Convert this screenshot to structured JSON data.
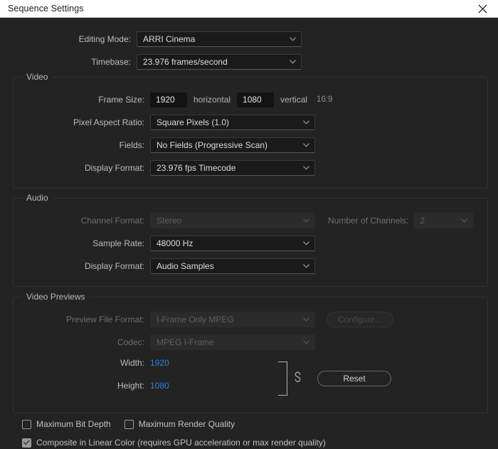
{
  "window": {
    "title": "Sequence Settings",
    "close_icon": "close-icon"
  },
  "top": {
    "editing_mode": {
      "label": "Editing Mode:",
      "value": "ARRI Cinema"
    },
    "timebase": {
      "label": "Timebase:",
      "value": "23.976  frames/second"
    }
  },
  "video": {
    "legend": "Video",
    "frame_size": {
      "label": "Frame Size:",
      "horizontal_value": "1920",
      "horizontal_text": "horizontal",
      "vertical_value": "1080",
      "vertical_text": "vertical",
      "aspect_ratio": "16:9"
    },
    "pixel_aspect_ratio": {
      "label": "Pixel Aspect Ratio:",
      "value": "Square Pixels (1.0)"
    },
    "fields": {
      "label": "Fields:",
      "value": "No Fields (Progressive Scan)"
    },
    "display_format": {
      "label": "Display Format:",
      "value": "23.976 fps Timecode"
    }
  },
  "audio": {
    "legend": "Audio",
    "channel_format": {
      "label": "Channel Format:",
      "value": "Stereo"
    },
    "number_of_channels": {
      "label": "Number of Channels:",
      "value": "2"
    },
    "sample_rate": {
      "label": "Sample Rate:",
      "value": "48000 Hz"
    },
    "display_format": {
      "label": "Display Format:",
      "value": "Audio Samples"
    }
  },
  "video_previews": {
    "legend": "Video Previews",
    "preview_file_format": {
      "label": "Preview File Format:",
      "value": "I-Frame Only MPEG"
    },
    "configure_button": "Configure...",
    "codec": {
      "label": "Codec:",
      "value": "MPEG I-Frame"
    },
    "width": {
      "label": "Width:",
      "value": "1920"
    },
    "height": {
      "label": "Height:",
      "value": "1080"
    },
    "reset_button": "Reset",
    "link_icon": "chain-link-icon"
  },
  "checkboxes": [
    {
      "label": "Maximum Bit Depth",
      "checked": false
    },
    {
      "label": "Maximum Render Quality",
      "checked": false
    },
    {
      "label": "Composite in Linear Color (requires GPU acceleration or max render quality)",
      "checked": true
    }
  ],
  "colors": {
    "background": "#232323",
    "titlebar": "#ffffff",
    "accent_blue": "#2d7fd4",
    "field": "#1a1a1a",
    "input": "#131313"
  }
}
